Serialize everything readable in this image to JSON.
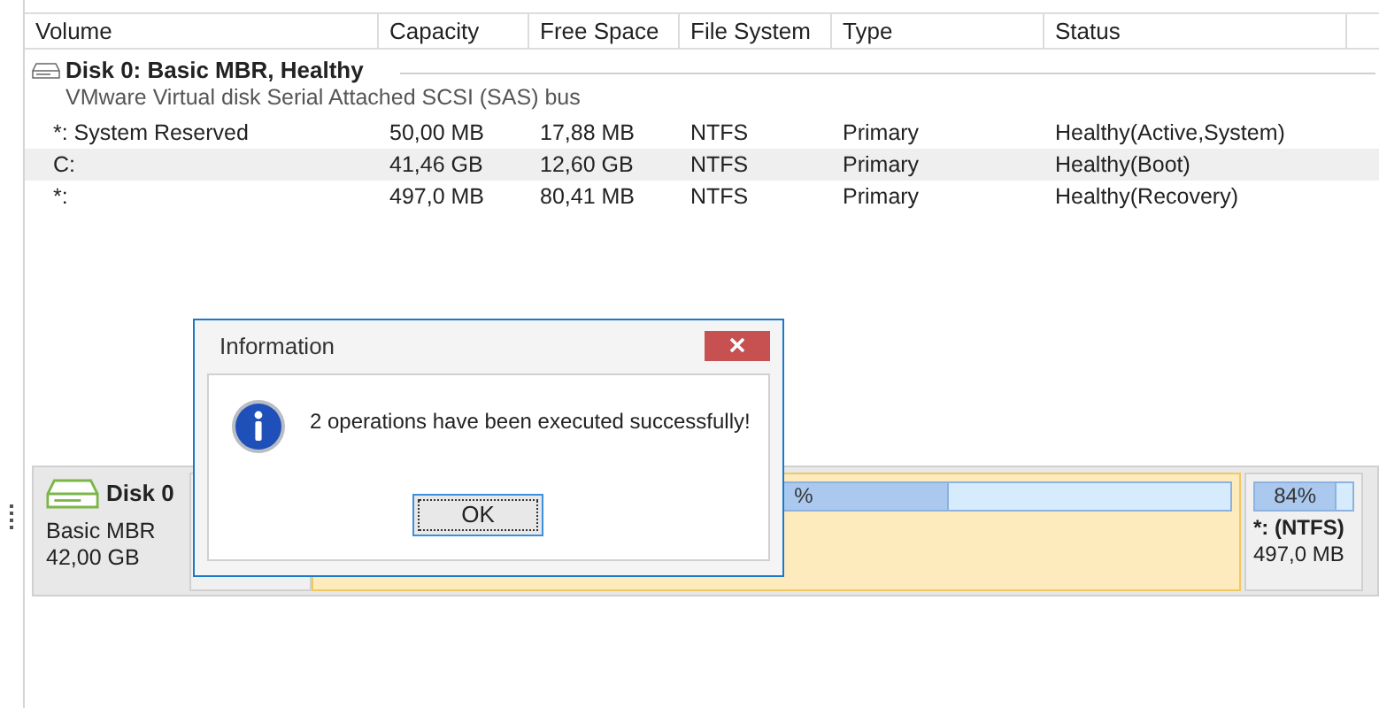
{
  "table": {
    "columns": [
      "Volume",
      "Capacity",
      "Free Space",
      "File System",
      "Type",
      "Status"
    ],
    "group": {
      "title": "Disk 0: Basic MBR, Healthy",
      "subtitle": "VMware Virtual disk Serial Attached SCSI (SAS) bus"
    },
    "rows": [
      {
        "cells": [
          "*: System Reserved",
          "50,00 MB",
          "17,88 MB",
          "NTFS",
          "Primary",
          "Healthy(Active,System)"
        ],
        "selected": false
      },
      {
        "cells": [
          "C:",
          "41,46 GB",
          "12,60 GB",
          "NTFS",
          "Primary",
          "Healthy(Boot)"
        ],
        "selected": true
      },
      {
        "cells": [
          "*:",
          "497,0 MB",
          "80,41 MB",
          "NTFS",
          "Primary",
          "Healthy(Recovery)"
        ],
        "selected": false
      }
    ]
  },
  "disk_map": {
    "disk": {
      "name": "Disk 0",
      "type": "Basic MBR",
      "size": "42,00 GB"
    },
    "partitions": [
      {
        "kind": "hidden"
      },
      {
        "kind": "partial",
        "usage_label": "%",
        "level": 0.69
      },
      {
        "kind": "full",
        "usage_label": "84%",
        "level": 0.84,
        "name": "*: (NTFS)",
        "size": "497,0 MB"
      }
    ]
  },
  "dialog": {
    "title": "Information",
    "message": "2 operations have been executed successfully!",
    "button": "OK"
  }
}
